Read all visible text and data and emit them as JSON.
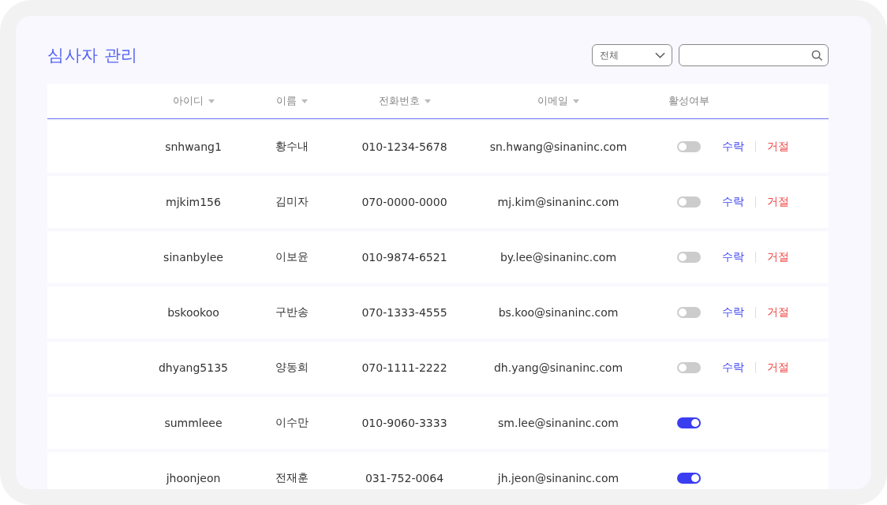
{
  "title": "심사자 관리",
  "filter": {
    "value": "전체"
  },
  "table": {
    "columns": [
      {
        "label": "아이디",
        "sortable": true
      },
      {
        "label": "이름",
        "sortable": true
      },
      {
        "label": "전화번호",
        "sortable": true
      },
      {
        "label": "이메일",
        "sortable": true
      },
      {
        "label": "활성여부",
        "sortable": false
      }
    ],
    "rows": [
      {
        "id": "snhwang1",
        "name": "황수내",
        "phone": "010-1234-5678",
        "email": "sn.hwang@sinaninc.com",
        "active": false,
        "actions": [
          {
            "label": "수락",
            "kind": "accept"
          },
          {
            "label": "거절",
            "kind": "reject"
          }
        ]
      },
      {
        "id": "mjkim156",
        "name": "김미자",
        "phone": "070-0000-0000",
        "email": "mj.kim@sinaninc.com",
        "active": false,
        "actions": [
          {
            "label": "수락",
            "kind": "accept"
          },
          {
            "label": "거절",
            "kind": "reject"
          }
        ]
      },
      {
        "id": "sinanbylee",
        "name": "이보윤",
        "phone": "010-9874-6521",
        "email": "by.lee@sinaninc.com",
        "active": false,
        "actions": [
          {
            "label": "수락",
            "kind": "accept"
          },
          {
            "label": "거절",
            "kind": "reject"
          }
        ]
      },
      {
        "id": "bskookoo",
        "name": "구반송",
        "phone": "070-1333-4555",
        "email": "bs.koo@sinaninc.com",
        "active": false,
        "actions": [
          {
            "label": "수락",
            "kind": "accept"
          },
          {
            "label": "거절",
            "kind": "reject"
          }
        ]
      },
      {
        "id": "dhyang5135",
        "name": "양동희",
        "phone": "070-1111-2222",
        "email": "dh.yang@sinaninc.com",
        "active": false,
        "actions": [
          {
            "label": "수락",
            "kind": "accept"
          },
          {
            "label": "거절",
            "kind": "reject"
          }
        ]
      },
      {
        "id": "summleee",
        "name": "이수만",
        "phone": "010-9060-3333",
        "email": "sm.lee@sinaninc.com",
        "active": true
      },
      {
        "id": "jhoonjeon",
        "name": "전재훈",
        "phone": "031-752-0064",
        "email": "jh.jeon@sinaninc.com",
        "active": true
      }
    ]
  }
}
